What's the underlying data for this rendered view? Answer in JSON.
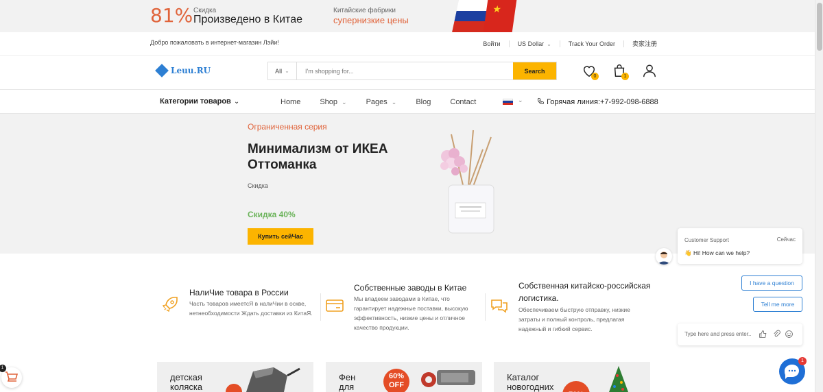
{
  "promo": {
    "percent": "81%",
    "discount_label": "Скидка",
    "made_in": "Произведено в Китае",
    "factories_label": "Китайские фабрики",
    "low_prices": "супернизкие цены"
  },
  "topbar": {
    "welcome": "Добро пожаловать в интернет-магазин Лэйи!",
    "login": "Войти",
    "currency": "US Dollar",
    "track": "Track Your Order",
    "seller_register": "卖家注册"
  },
  "header": {
    "logo_text": "Leuu.RU",
    "search_category": "All",
    "search_placeholder": "I'm shopping for...",
    "search_button": "Search",
    "wishlist_count": "0",
    "cart_count": "1"
  },
  "nav": {
    "categories_label": "Категории товаров",
    "items": [
      "Home",
      "Shop",
      "Pages",
      "Blog",
      "Contact"
    ],
    "hotline": "Горячая линия:+7-992-098-6888"
  },
  "hero": {
    "limited": "Ограниченная серия",
    "title": "Минимализм от ИКЕА Оттоманка",
    "discount_label": "Скидка",
    "discount_value": "Скидка 40%",
    "button": "Купить сейЧас"
  },
  "features": [
    {
      "title": "НалиЧие товара в России",
      "desc": "Часть товаров имеетсЯ в налиЧии в оскве, нетнеобходимости Ждать доставки из КитаЯ."
    },
    {
      "title": "Собственные заводы в Китае",
      "desc": "Мы владеем заводами в Китае, что гарантирует надежные поставки, высокую эффективность, низкие цены и отличное качество продукции."
    },
    {
      "title": "Собственная китайско-российская логистика.",
      "desc": "Обеспечиваем быструю отправку, низкие затраты и полный контроль, предлагая надежный и гибкий сервис."
    }
  ],
  "cards": [
    {
      "title": "детская коляска"
    },
    {
      "title": "Фен для",
      "badge": "60% OFF"
    },
    {
      "title": "Каталог новогодних",
      "badge": "70%"
    }
  ],
  "chat": {
    "support_label": "Customer Support",
    "now": "Сейчас",
    "greeting": "Hi! How can we help?",
    "q1": "I have a question",
    "q2": "Tell me more",
    "input_placeholder": "Type here and press enter..",
    "unread": "1"
  },
  "floating_cart": {
    "count": "1"
  },
  "colors": {
    "accent": "#fcb400",
    "orange": "#e0633a",
    "green": "#6bb35a",
    "blue": "#2d7fd3"
  }
}
